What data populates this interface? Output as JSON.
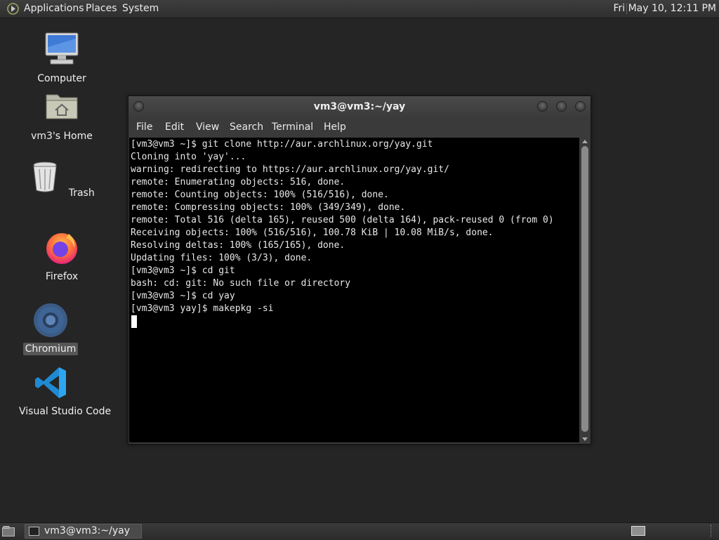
{
  "top_panel": {
    "logo_icon": "distro-logo-icon",
    "menus": [
      "Applications",
      "Places",
      "System"
    ],
    "clock": "Fri May 10, 12:11 PM"
  },
  "desktop_icons": [
    {
      "label": "Computer",
      "icon": "computer-icon"
    },
    {
      "label": "vm3's Home",
      "icon": "home-folder-icon"
    },
    {
      "label": "Trash",
      "icon": "trash-icon"
    },
    {
      "label": "Firefox",
      "icon": "firefox-icon"
    },
    {
      "label": "Chromium",
      "icon": "chromium-icon",
      "selected": true
    },
    {
      "label": "Visual Studio Code",
      "icon": "vscode-icon"
    }
  ],
  "terminal_window": {
    "title": "vm3@vm3:~/yay",
    "menu": [
      "File",
      "Edit",
      "View",
      "Search",
      "Terminal",
      "Help"
    ],
    "lines": [
      "[vm3@vm3 ~]$ git clone http://aur.archlinux.org/yay.git",
      "Cloning into 'yay'...",
      "warning: redirecting to https://aur.archlinux.org/yay.git/",
      "remote: Enumerating objects: 516, done.",
      "remote: Counting objects: 100% (516/516), done.",
      "remote: Compressing objects: 100% (349/349), done.",
      "remote: Total 516 (delta 165), reused 500 (delta 164), pack-reused 0 (from 0)",
      "Receiving objects: 100% (516/516), 100.78 KiB | 10.08 MiB/s, done.",
      "Resolving deltas: 100% (165/165), done.",
      "Updating files: 100% (3/3), done.",
      "[vm3@vm3 ~]$ cd git",
      "bash: cd: git: No such file or directory",
      "[vm3@vm3 ~]$ cd yay",
      "[vm3@vm3 yay]$ makepkg -si"
    ]
  },
  "taskbar": {
    "window_button": "vm3@vm3:~/yay"
  },
  "colors": {
    "desktop_bg": "#252525",
    "terminal_bg": "#000000",
    "terminal_fg": "#e8e8e8",
    "panel_bg": "#333333"
  }
}
